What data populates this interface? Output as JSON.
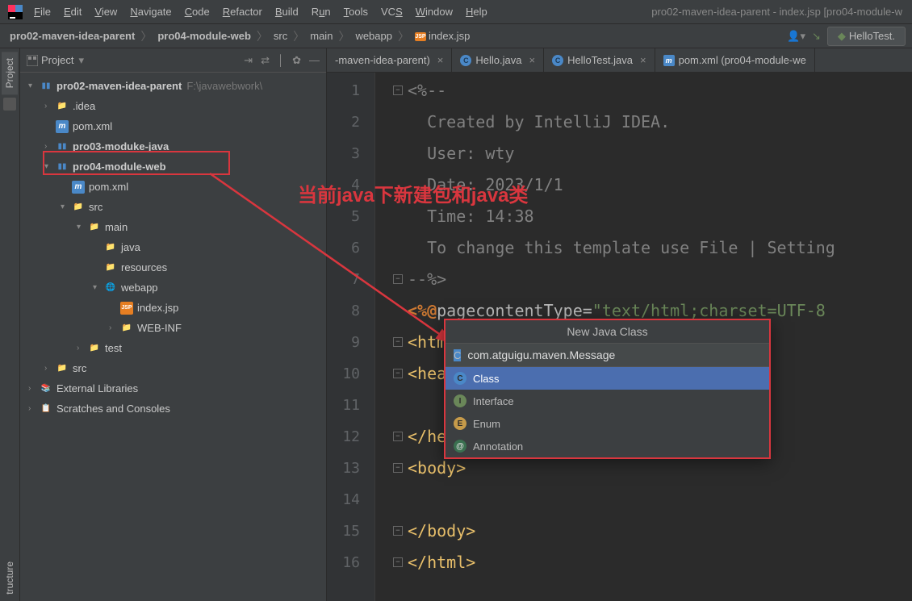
{
  "window_title": "pro02-maven-idea-parent - index.jsp [pro04-module-w",
  "menu": [
    "File",
    "Edit",
    "View",
    "Navigate",
    "Code",
    "Refactor",
    "Build",
    "Run",
    "Tools",
    "VCS",
    "Window",
    "Help"
  ],
  "breadcrumb": {
    "items": [
      "pro02-maven-idea-parent",
      "pro04-module-web",
      "src",
      "main",
      "webapp",
      "index.jsp"
    ]
  },
  "run_config_label": "HelloTest.",
  "project_panel": {
    "title": "Project"
  },
  "tree": {
    "root_label": "pro02-maven-idea-parent",
    "root_hint": "F:\\javawebwork\\",
    "idea": ".idea",
    "pom1": "pom.xml",
    "mod03": "pro03-moduke-java",
    "mod04": "pro04-module-web",
    "pom2": "pom.xml",
    "src": "src",
    "main": "main",
    "java": "java",
    "resources": "resources",
    "webapp": "webapp",
    "indexjsp": "index.jsp",
    "webinf": "WEB-INF",
    "test": "test",
    "src2": "src",
    "extlib": "External Libraries",
    "scratches": "Scratches and Consoles"
  },
  "editor_tabs": [
    {
      "label": "-maven-idea-parent)",
      "type": "xml"
    },
    {
      "label": "Hello.java",
      "type": "java"
    },
    {
      "label": "HelloTest.java",
      "type": "java"
    },
    {
      "label": "pom.xml (pro04-module-we",
      "type": "xml"
    }
  ],
  "code_lines": [
    "<%--",
    "  Created by IntelliJ IDEA.",
    "  User: wty",
    "  Date: 2023/1/1",
    "  Time: 14:38",
    "  To change this template use File | Setting",
    "--%>",
    "<%@ page contentType=\"text/html;charset=UTF-8",
    "<html>",
    "<head>",
    "",
    "</head>",
    "<body>",
    "",
    "</body>",
    "</html>"
  ],
  "annotation_text": "当前java下新建包和java类",
  "new_class_popup": {
    "title": "New Java Class",
    "input_value": "com.atguigu.maven.Message",
    "items": [
      "Class",
      "Interface",
      "Enum",
      "Annotation"
    ]
  },
  "vertical_tabs": {
    "project": "Project",
    "structure": "tructure"
  }
}
